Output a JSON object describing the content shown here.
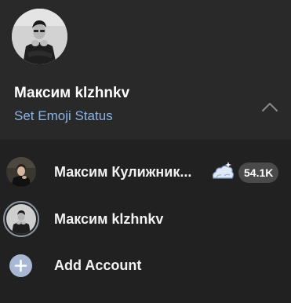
{
  "header": {
    "name": "Максим klzhnkv",
    "status_link": "Set Emoji Status"
  },
  "accounts": [
    {
      "name": "Максим Кулижник...",
      "badge": "54.1K",
      "emoji_status_icon": "cloud-emoji-icon",
      "active": false
    },
    {
      "name": "Максим klzhnkv",
      "active": true
    }
  ],
  "add_account": {
    "label": "Add Account",
    "icon": "plus-icon"
  },
  "colors": {
    "header_bg": "#292929",
    "menu_bg": "#212121",
    "link": "#8ab4e6",
    "badge_bg": "#4a4a4a",
    "add_icon_bg": "#a8b8d4"
  }
}
